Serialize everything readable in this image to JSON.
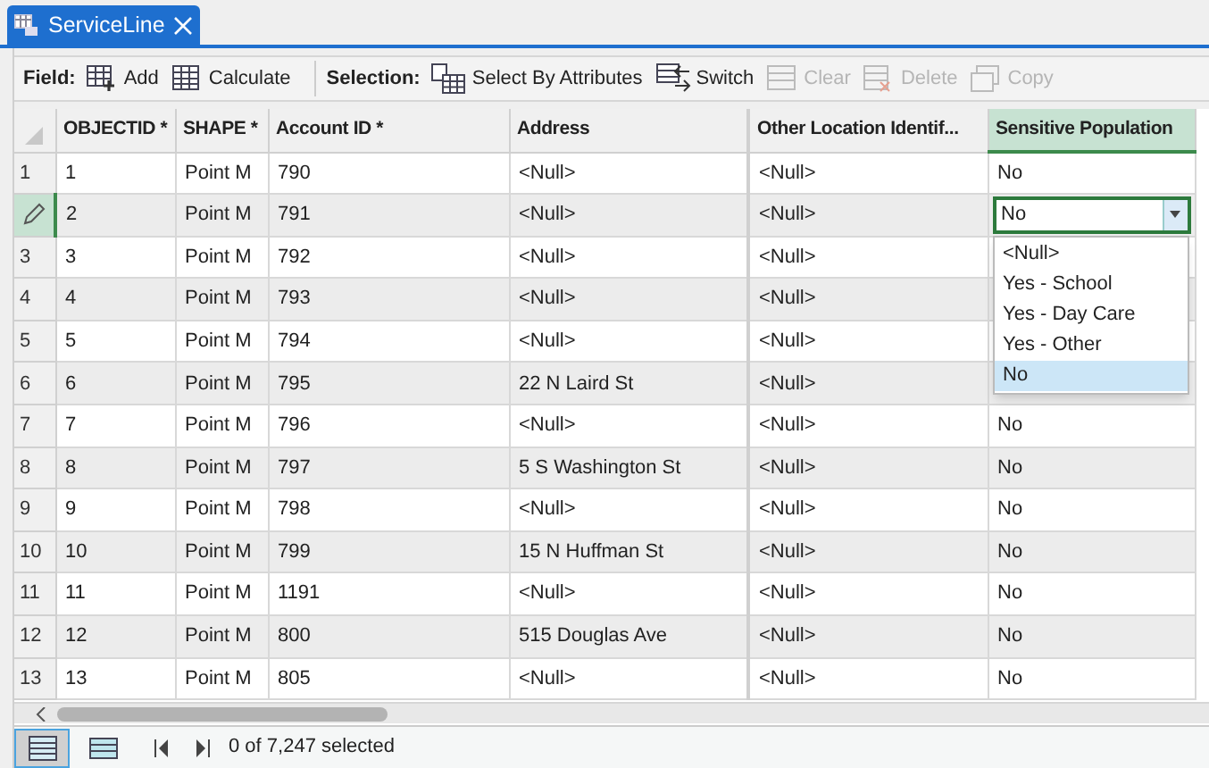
{
  "tab": {
    "title": "ServiceLine",
    "selected": true
  },
  "toolbar": {
    "groups": [
      {
        "label": "Field:",
        "buttons": [
          {
            "label": "Add",
            "disabled": false
          },
          {
            "label": "Calculate",
            "disabled": false
          }
        ]
      },
      {
        "label": "Selection:",
        "buttons": [
          {
            "label": "Select By Attributes",
            "disabled": false
          },
          {
            "label": "Switch",
            "disabled": false
          },
          {
            "label": "Clear",
            "disabled": true
          },
          {
            "label": "Delete",
            "disabled": true
          },
          {
            "label": "Copy",
            "disabled": true
          }
        ]
      }
    ]
  },
  "table": {
    "columns": [
      {
        "label": "OBJECTID *",
        "selected": false
      },
      {
        "label": "SHAPE *",
        "selected": false
      },
      {
        "label": "Account ID *",
        "selected": false
      },
      {
        "label": "Address",
        "selected": false
      },
      {
        "label": "Other Location Identif...",
        "selected": false
      },
      {
        "label": "Sensitive Population",
        "selected": true
      }
    ],
    "rows": [
      {
        "number": "1",
        "editing": false,
        "cells": [
          "1",
          "Point M",
          "790",
          "<Null>",
          "<Null>",
          "No"
        ]
      },
      {
        "editing": true,
        "cells": [
          "2",
          "Point M",
          "791",
          "<Null>",
          "<Null>",
          "No"
        ]
      },
      {
        "number": "3",
        "editing": false,
        "cells": [
          "3",
          "Point M",
          "792",
          "<Null>",
          "<Null>",
          ""
        ]
      },
      {
        "number": "4",
        "editing": false,
        "cells": [
          "4",
          "Point M",
          "793",
          "<Null>",
          "<Null>",
          ""
        ]
      },
      {
        "number": "5",
        "editing": false,
        "cells": [
          "5",
          "Point M",
          "794",
          "<Null>",
          "<Null>",
          ""
        ]
      },
      {
        "number": "6",
        "editing": false,
        "cells": [
          "6",
          "Point M",
          "795",
          "22 N Laird St",
          "<Null>",
          ""
        ]
      },
      {
        "number": "7",
        "editing": false,
        "cells": [
          "7",
          "Point M",
          "796",
          "<Null>",
          "<Null>",
          "No"
        ]
      },
      {
        "number": "8",
        "editing": false,
        "cells": [
          "8",
          "Point M",
          "797",
          "5 S Washington St",
          "<Null>",
          "No"
        ]
      },
      {
        "number": "9",
        "editing": false,
        "cells": [
          "9",
          "Point M",
          "798",
          "<Null>",
          "<Null>",
          "No"
        ]
      },
      {
        "number": "10",
        "editing": false,
        "cells": [
          "10",
          "Point M",
          "799",
          "15 N Huffman St",
          "<Null>",
          "No"
        ]
      },
      {
        "number": "11",
        "editing": false,
        "cells": [
          "11",
          "Point M",
          "1191",
          "<Null>",
          "<Null>",
          "No"
        ]
      },
      {
        "number": "12",
        "editing": false,
        "cells": [
          "12",
          "Point M",
          "800",
          "515 Douglas Ave",
          "<Null>",
          "No"
        ]
      },
      {
        "number": "13",
        "editing": false,
        "cells": [
          "13",
          "Point M",
          "805",
          "<Null>",
          "<Null>",
          "No"
        ]
      }
    ]
  },
  "dropdown": {
    "options": [
      {
        "label": "<Null>",
        "selected": false
      },
      {
        "label": "Yes - School",
        "selected": false
      },
      {
        "label": "Yes - Day Care",
        "selected": false
      },
      {
        "label": "Yes - Other",
        "selected": false
      },
      {
        "label": "No",
        "selected": true
      }
    ]
  },
  "status_bar": {
    "views": [
      {
        "selected": true
      },
      {
        "selected": false
      }
    ],
    "text": "0 of 7,247 selected"
  }
}
